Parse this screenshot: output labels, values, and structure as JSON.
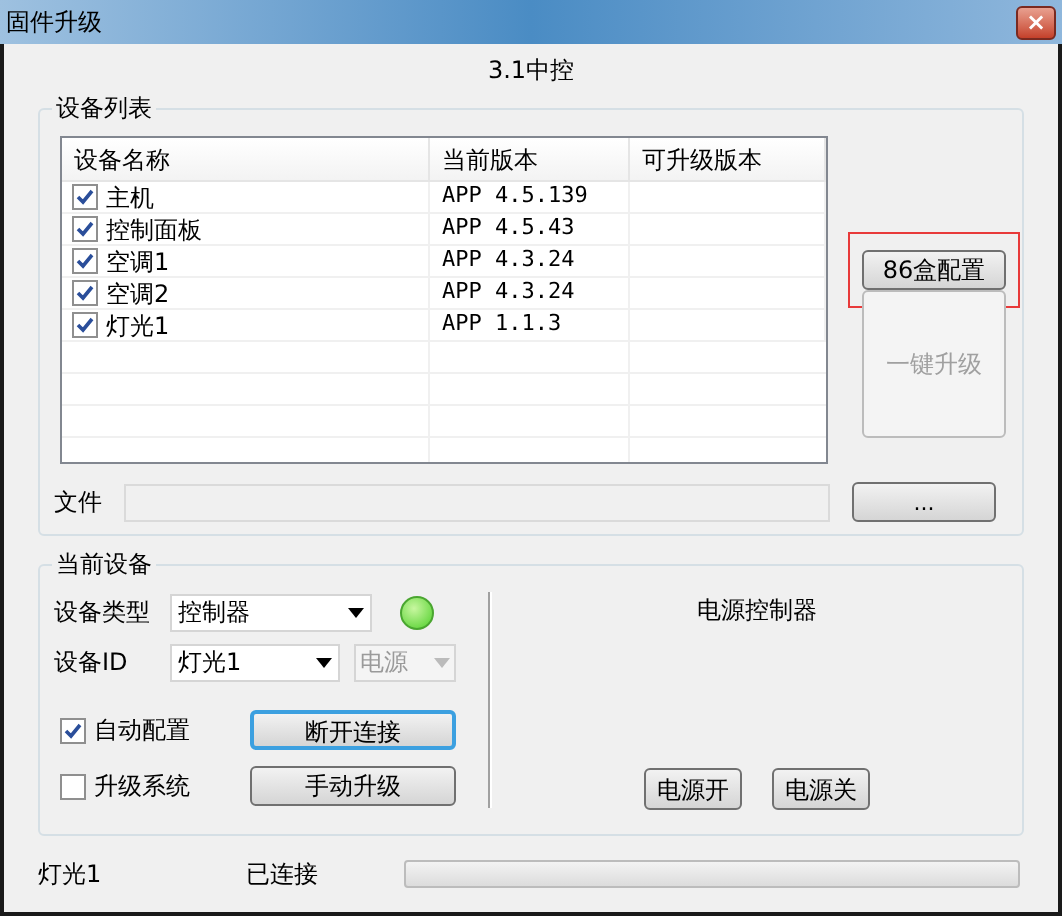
{
  "window": {
    "title": "固件升级",
    "close": "×"
  },
  "heading": "3.1中控",
  "device_list": {
    "title": "设备列表",
    "columns": [
      "设备名称",
      "当前版本",
      "可升级版本"
    ],
    "rows": [
      {
        "name": "主机",
        "version": "APP 4.5.139",
        "checked": true
      },
      {
        "name": "控制面板",
        "version": "APP 4.5.43",
        "checked": true
      },
      {
        "name": "空调1",
        "version": "APP 4.3.24",
        "checked": true
      },
      {
        "name": "空调2",
        "version": "APP 4.3.24",
        "checked": true
      },
      {
        "name": "灯光1",
        "version": "APP 1.1.3",
        "checked": true
      }
    ],
    "config_button": {
      "label": "86盒配置",
      "highlighted": true
    },
    "upgrade_all_button": {
      "label": "一键升级",
      "disabled": true
    },
    "file": {
      "label": "文件",
      "browse": "..."
    }
  },
  "current_device": {
    "title": "当前设备",
    "type_label": "设备类型",
    "type_value": "控制器",
    "connected": true,
    "id_label": "设备ID",
    "id_value": "灯光1",
    "sub_value": "电源",
    "sub_disabled": true,
    "auto_config": {
      "label": "自动配置",
      "checked": true
    },
    "upgrade_system": {
      "label": "升级系统",
      "checked": false
    },
    "disconnect_button": "断开连接",
    "manual_upgrade_button": "手动升级",
    "panel_title": "电源控制器",
    "power_on": "电源开",
    "power_off": "电源关"
  },
  "status_bar": {
    "device": "灯光1",
    "state": "已连接",
    "level": 0
  }
}
